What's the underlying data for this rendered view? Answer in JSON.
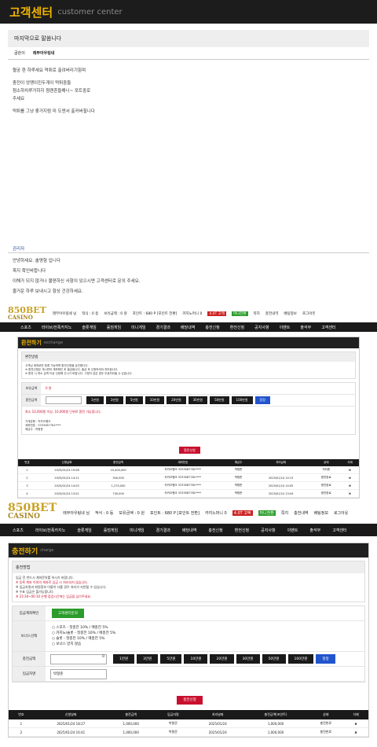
{
  "cc": {
    "title": "고객센터",
    "subtitle": "customer center",
    "subject": "마지막으로 말씀니다",
    "writer_label": "글쓴이",
    "writer_name": "레부아우링네",
    "body": [
      "혈궁 환 하루세요 먹튀로 출려버리기힘며",
      "충전이 엉맹이진두게이 먹튀중들",
      "첨소하치루거하지 첨렌흔들해니~ 포트중로",
      "주세요",
      "먹튀를 그냥 좋거지럼 미 도엔서 출커버힐니다"
    ],
    "admin_label": "관리자",
    "admin_lines": [
      "안녕하세요. 솔명형 입니다",
      "목지 확인바합니다",
      "이해가 되지 않거나 불편하신 사항이 있으시면 고객센터로 문의 주세요.",
      "즐거운 하루 보내시고 항상 건강하세요."
    ]
  },
  "site": {
    "logo_main": "850BET",
    "logo_sub": "CASINO",
    "user": "레부아우링네 님",
    "topinfo": [
      "적식 : 0 등",
      "보유금액 : 0 원",
      "포인트 : 680 P [포인트 전환]",
      "카지노머니 0",
      "쪽지",
      "충전내역",
      "배팅정보",
      "로그아웃"
    ],
    "badge_red": "4.0T 고액",
    "badge_green": "머니전환",
    "nav": [
      "스포츠",
      "라이브/전폭카지노",
      "슬롯게임",
      "홀덤게임",
      "미니게임",
      "경기결과",
      "배당내역",
      "충전신청",
      "환전신청",
      "공지사항",
      "이벤트",
      "출석부",
      "고객센터"
    ]
  },
  "exchange": {
    "title": "환전하기",
    "subtitle": "exchange",
    "box_title": "환전방법",
    "notes": [
      "고객님 계좌로만 등록 가능하며 환전신청을 승인합니다.",
      "※ 환전신청은 게시판의 계좌확인 후 출금됩니다. 출금 후 신청하셔야 처리됩니다.",
      "※ 환전 시 최소 금액 이상 신청해 주시기 바랍니다. 그렇지 않은 경우 무효처리될 수 있습니다."
    ],
    "hold_label": "보유금액",
    "hold_value": "0 원",
    "amount_label": "환전금액",
    "amounts": [
      "1만원",
      "3만원",
      "5만원",
      "10만원",
      "20만원",
      "30만원",
      "50만원",
      "100만원"
    ],
    "reset": "정정",
    "warn": "최소 10,000원 이상, 10,000원 단위로 환전 가능합니다.",
    "acct_lines": [
      "가계은행 : 카카오뱅크",
      "계좌번호 : 3333087781****",
      "예금주 : 박형준"
    ],
    "submit": "환전신청",
    "table_head": [
      "번호",
      "신청날짜",
      "환전금액",
      "계좌번호",
      "예금주",
      "처리날짜",
      "상태",
      "삭제"
    ],
    "table_rows": [
      [
        "1",
        "2025/01/24 19:08",
        "10,400,000",
        "카카오뱅크 3333087781****",
        "박형준",
        "",
        "처리중",
        "✖"
      ],
      [
        "2",
        "2025/01/24 14:11",
        "300,000",
        "카카오뱅크 3333087781****",
        "박형준",
        "2025/01/24 14:13",
        "환전완료",
        "✖"
      ],
      [
        "3",
        "2025/01/24 14:03",
        "1,270,000",
        "카카오뱅크 3333087781****",
        "박형준",
        "2025/01/24 14:05",
        "환전완료",
        "✖"
      ],
      [
        "4",
        "2025/01/24 13:01",
        "740,000",
        "카카오뱅크 3333087781****",
        "박형준",
        "2025/01/24 13:04",
        "환전완료",
        "✖"
      ]
    ]
  },
  "charge": {
    "title": "충전하기",
    "subtitle": "charge",
    "box_title": "충전방법",
    "notes": [
      "입금 전 반드시 계좌문의를 하시기 바랍니다.",
      "※ 등록 계좌 이외의 계좌로 입금 시 처리되지 않습니다.",
      "※ 입금자명과 회원정보 이름이 다를 경우 처리가 지연될 수 있습니다.",
      "※ 수표 입금은 불가능합니다.",
      "※ 23:30~00:10 은행 점검시간에는 입금을 삼가주세요."
    ],
    "account_label": "입금계좌확인",
    "account_button": "고객센터문의",
    "bonus_label": "보너스선택",
    "bonus_options": [
      "스포츠 - 첫충전 10% / 매충전 5%",
      "카지노/슬롯 - 첫충전 10% / 매충전 5%",
      "슬롯 - 첫충전 10% / 매충전 5%",
      "보너스 받지 않음"
    ],
    "amount_label": "충전금액",
    "amount_value": "0",
    "amounts": [
      "1만원",
      "3만원",
      "5만원",
      "10만원",
      "20만원",
      "30만원",
      "50만원",
      "100만원"
    ],
    "reset": "정정",
    "depositor_label": "입금자명",
    "depositor_value": "박형준",
    "submit": "충전신청",
    "table_head": [
      "번호",
      "신청날짜",
      "충전금액",
      "입금자명",
      "처리날짜",
      "충전금액(포인트)",
      "상태",
      "삭제"
    ],
    "table_rows": [
      [
        "1",
        "2025/01/24 18:27",
        "1,000,000",
        "박형준",
        "2025/01/24",
        "1,000,000",
        "충전완료",
        "✖"
      ],
      [
        "2",
        "2025/01/24 16:41",
        "1,000,000",
        "박형준",
        "2025/01/24",
        "1,000,000",
        "충전완료",
        "✖"
      ]
    ]
  }
}
